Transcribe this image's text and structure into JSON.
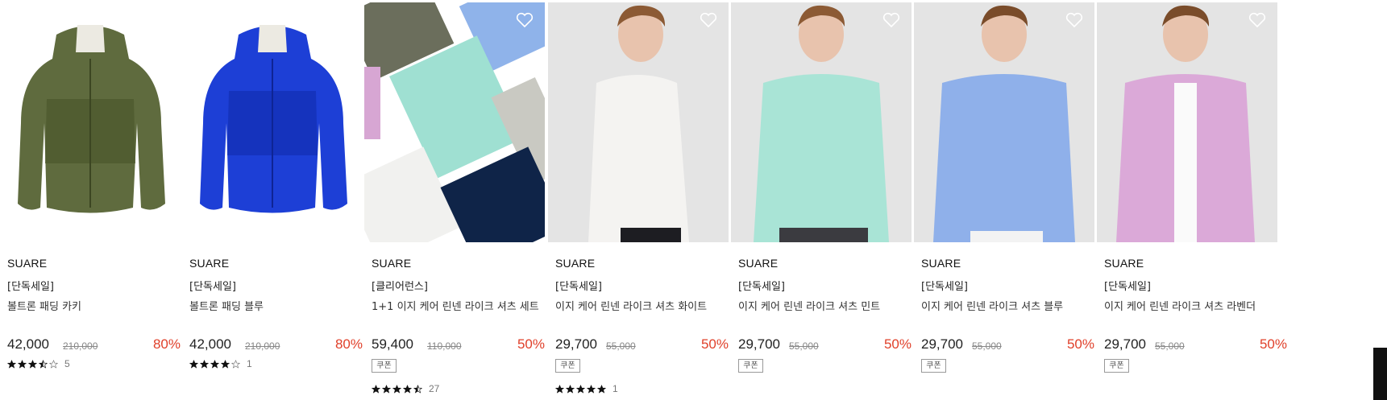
{
  "products": [
    {
      "brand": "SUARE",
      "tag": "[단독세일]",
      "name": "볼트론 패딩 카키",
      "price": "42,000",
      "original_price": "210,000",
      "discount": "80%",
      "coupon": "",
      "rating_stars": 3.5,
      "review_count": "5",
      "image": "khaki-padded-jacket",
      "image_color": "#5f6b3e"
    },
    {
      "brand": "SUARE",
      "tag": "[단독세일]",
      "name": "볼트론 패딩 블루",
      "price": "42,000",
      "original_price": "210,000",
      "discount": "80%",
      "coupon": "",
      "rating_stars": 4,
      "review_count": "1",
      "image": "blue-padded-jacket",
      "image_color": "#1d3fd6"
    },
    {
      "brand": "SUARE",
      "tag": "[클리어런스]",
      "name": "1+1 이지 케어 린넨 라이크 셔츠 세트",
      "price": "59,400",
      "original_price": "110,000",
      "discount": "50%",
      "coupon": "쿠폰",
      "rating_stars": 4.5,
      "review_count": "27",
      "image": "shirt-set-flatlay",
      "image_color": "#9fe0d2"
    },
    {
      "brand": "SUARE",
      "tag": "[단독세일]",
      "name": "이지 케어 린넨 라이크 셔츠 화이트",
      "price": "29,700",
      "original_price": "55,000",
      "discount": "50%",
      "coupon": "쿠폰",
      "rating_stars": 5,
      "review_count": "1",
      "image": "model-white-shirt",
      "image_color": "#f4f3f1"
    },
    {
      "brand": "SUARE",
      "tag": "[단독세일]",
      "name": "이지 케어 린넨 라이크 셔츠 민트",
      "price": "29,700",
      "original_price": "55,000",
      "discount": "50%",
      "coupon": "쿠폰",
      "rating_stars": 0,
      "review_count": "",
      "image": "model-mint-shirt",
      "image_color": "#a9e4d6"
    },
    {
      "brand": "SUARE",
      "tag": "[단독세일]",
      "name": "이지 케어 린넨 라이크 셔츠 블루",
      "price": "29,700",
      "original_price": "55,000",
      "discount": "50%",
      "coupon": "쿠폰",
      "rating_stars": 0,
      "review_count": "",
      "image": "model-blue-shirt",
      "image_color": "#8fb0ea"
    },
    {
      "brand": "SUARE",
      "tag": "[단독세일]",
      "name": "이지 케어 린넨 라이크 셔츠 라벤더",
      "price": "29,700",
      "original_price": "55,000",
      "discount": "50%",
      "coupon": "쿠폰",
      "rating_stars": 0,
      "review_count": "",
      "image": "model-lavender-shirt",
      "image_color": "#dba9d8"
    }
  ],
  "colors": {
    "discount": "#e0402a",
    "text": "#222222",
    "strike": "#888888"
  },
  "icons": {
    "wishlist": "heart-outline-icon",
    "star": "star-icon"
  }
}
